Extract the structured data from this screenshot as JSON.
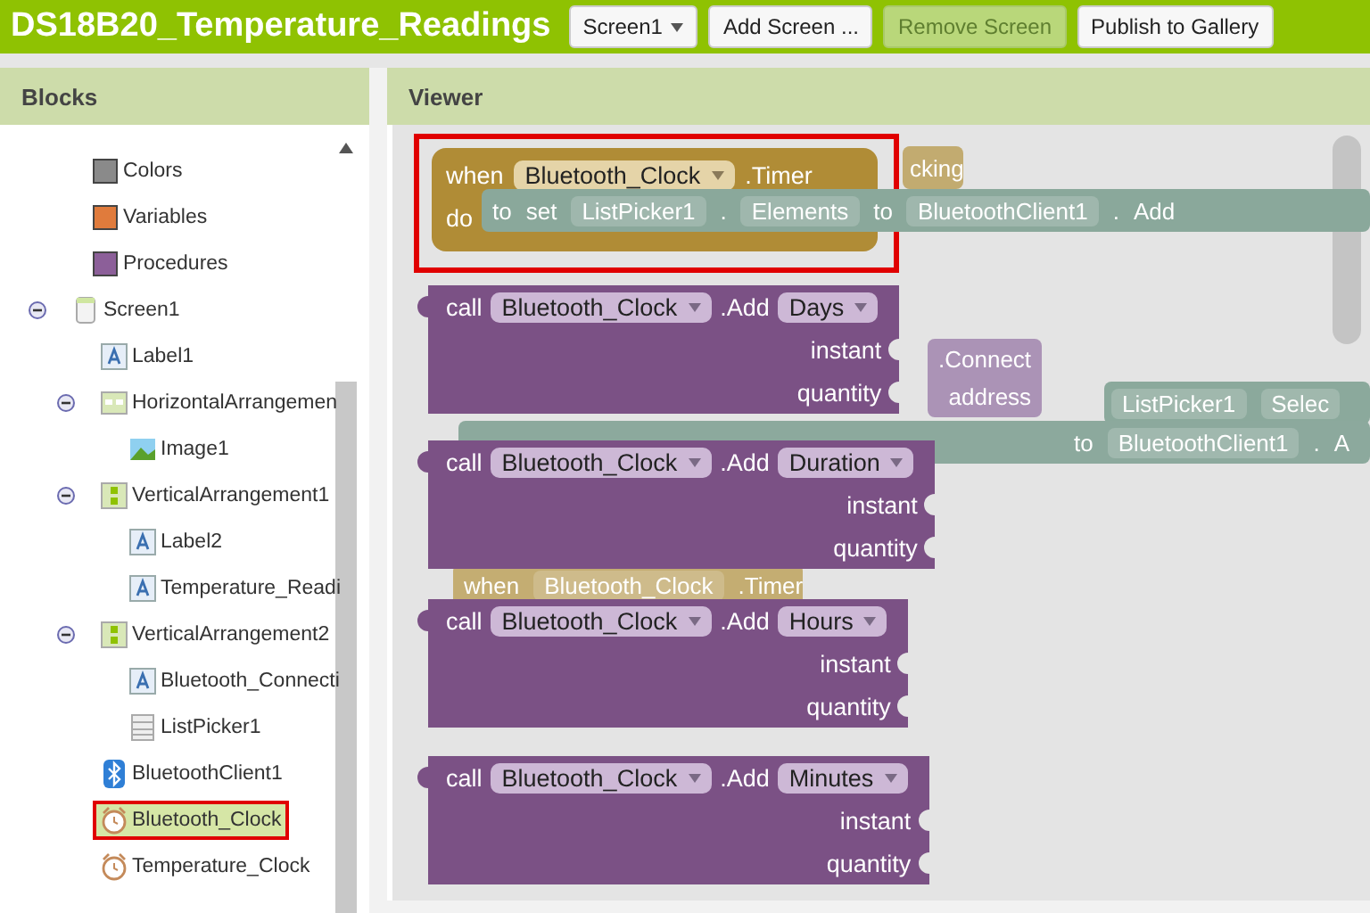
{
  "app_bar": {
    "title": "DS18B20_Temperature_Readings",
    "buttons": [
      {
        "label": "Screen1",
        "kind": "dropdown",
        "disabled": false
      },
      {
        "label": "Add Screen ...",
        "kind": "plain",
        "disabled": false
      },
      {
        "label": "Remove Screen",
        "kind": "plain",
        "disabled": true
      },
      {
        "label": "Publish to Gallery",
        "kind": "plain",
        "disabled": false
      }
    ]
  },
  "blocks_panel": {
    "title": "Blocks",
    "builtin_blocks": [
      {
        "label": "Colors",
        "color": "#8a8a8a"
      },
      {
        "label": "Variables",
        "color": "#e07b3c"
      },
      {
        "label": "Procedures",
        "color": "#8c5f99"
      }
    ],
    "tree": [
      {
        "label": "Screen1",
        "kind": "screen",
        "expanded": true,
        "selected": false,
        "highlighted": false,
        "children": [
          {
            "label": "Label1",
            "kind": "label",
            "selected": false,
            "highlighted": false
          },
          {
            "label": "HorizontalArrangemen",
            "kind": "horizontal-arrangement",
            "expanded": true,
            "selected": false,
            "highlighted": false,
            "children": [
              {
                "label": "Image1",
                "kind": "image",
                "selected": false,
                "highlighted": false
              }
            ]
          },
          {
            "label": "VerticalArrangement1",
            "kind": "vertical-arrangement",
            "expanded": true,
            "selected": false,
            "highlighted": false,
            "children": [
              {
                "label": "Label2",
                "kind": "label",
                "selected": false,
                "highlighted": false
              },
              {
                "label": "Temperature_Readi",
                "kind": "label",
                "selected": false,
                "highlighted": false
              }
            ]
          },
          {
            "label": "VerticalArrangement2",
            "kind": "vertical-arrangement",
            "expanded": true,
            "selected": false,
            "highlighted": false,
            "children": [
              {
                "label": "Bluetooth_Connecti",
                "kind": "label",
                "selected": false,
                "highlighted": false
              },
              {
                "label": "ListPicker1",
                "kind": "list-picker",
                "selected": false,
                "highlighted": false
              }
            ]
          },
          {
            "label": "BluetoothClient1",
            "kind": "bluetooth",
            "selected": false,
            "highlighted": false
          },
          {
            "label": "Bluetooth_Clock",
            "kind": "clock",
            "selected": true,
            "highlighted": true
          },
          {
            "label": "Temperature_Clock",
            "kind": "clock",
            "selected": false,
            "highlighted": false
          }
        ]
      }
    ]
  },
  "viewer": {
    "title": "Viewer",
    "ghost_blocks": [
      {
        "color": "#c2ab70",
        "words": [
          {
            "text": "cking",
            "pill": false
          }
        ]
      },
      {
        "color": "#8aa89b",
        "words": [
          {
            "text": "to",
            "pill": false
          },
          {
            "text": "set",
            "pill": false
          },
          {
            "text": "ListPicker1",
            "pill": true
          },
          {
            "text": ".",
            "pill": false
          },
          {
            "text": "Elements",
            "pill": true
          },
          {
            "text": "to",
            "pill": false
          },
          {
            "text": "BluetoothClient1",
            "pill": true
          },
          {
            "text": ".",
            "pill": false
          },
          {
            "text": "Add",
            "pill": false
          }
        ]
      },
      {
        "color": "#ab93b6",
        "words": [
          {
            "text": ".Connect",
            "pill": false
          },
          {
            "text": "address",
            "pill": false
          }
        ]
      },
      {
        "color": "#8ba99c",
        "words": [
          {
            "text": "ListPicker1",
            "pill": true
          },
          {
            "text": "Selec",
            "pill": true
          }
        ]
      },
      {
        "color": "#8ca99d",
        "words": [
          {
            "text": "to",
            "pill": false
          },
          {
            "text": "BluetoothClient1",
            "pill": true
          },
          {
            "text": ".",
            "pill": false
          },
          {
            "text": "A",
            "pill": false
          }
        ]
      },
      {
        "color": "#c4ad72",
        "words": [
          {
            "text": "when",
            "pill": false
          },
          {
            "text": "Bluetooth_Clock",
            "pill": true
          },
          {
            "text": ".Timer",
            "pill": false
          }
        ]
      }
    ],
    "event_block": {
      "keyword": "when",
      "component": "Bluetooth_Clock",
      "event": ".Timer",
      "body_keyword": "do",
      "highlighted": true
    },
    "call_blocks": [
      {
        "keyword": "call",
        "component": "Bluetooth_Clock",
        "method": ".Add",
        "option": "Days",
        "params": [
          "instant",
          "quantity"
        ]
      },
      {
        "keyword": "call",
        "component": "Bluetooth_Clock",
        "method": ".Add",
        "option": "Duration",
        "params": [
          "instant",
          "quantity"
        ]
      },
      {
        "keyword": "call",
        "component": "Bluetooth_Clock",
        "method": ".Add",
        "option": "Hours",
        "params": [
          "instant",
          "quantity"
        ]
      },
      {
        "keyword": "call",
        "component": "Bluetooth_Clock",
        "method": ".Add",
        "option": "Minutes",
        "params": [
          "instant",
          "quantity"
        ]
      }
    ]
  }
}
